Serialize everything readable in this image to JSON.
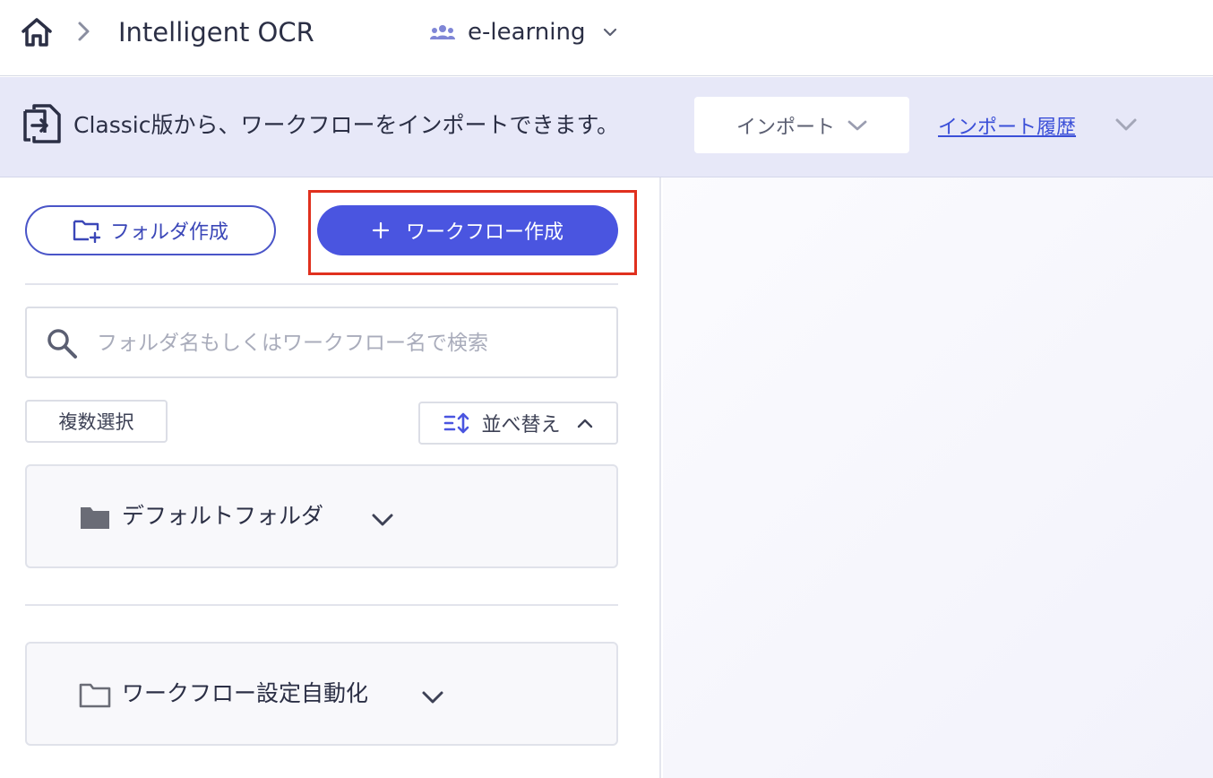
{
  "header": {
    "app_title": "Intelligent OCR",
    "workspace": "e-learning"
  },
  "banner": {
    "message": "Classic版から、ワークフローをインポートできます。",
    "import_label": "インポート",
    "history_label": "インポート履歴"
  },
  "actions": {
    "create_folder_label": "フォルダ作成",
    "create_workflow_label": "ワークフロー作成"
  },
  "search": {
    "placeholder": "フォルダ名もしくはワークフロー名で検索",
    "value": ""
  },
  "list_controls": {
    "multi_select_label": "複数選択",
    "sort_label": "並べ替え"
  },
  "folders": [
    {
      "label": "デフォルトフォルダ",
      "icon": "folder-filled-icon"
    },
    {
      "label": "ワークフロー設定自動化",
      "icon": "folder-outline-icon"
    }
  ],
  "colors": {
    "accent": "#4a55e0",
    "banner_bg": "#e7e8f8",
    "highlight": "#e0301e",
    "link": "#3b4fd8"
  }
}
